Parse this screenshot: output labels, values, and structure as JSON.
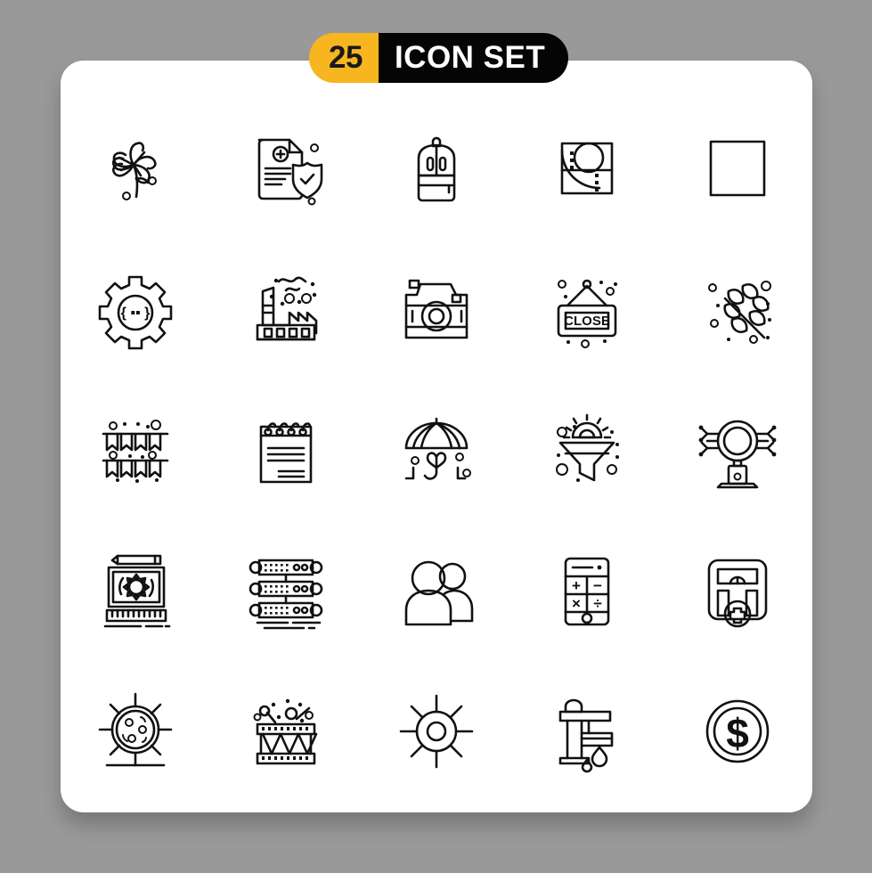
{
  "page": {
    "background_color": "#999999",
    "card_color": "#ffffff"
  },
  "header": {
    "count": "25",
    "title": "ICON SET",
    "count_bg": "#f7b620",
    "title_bg": "#050505",
    "count_text_color": "#1a1a1a",
    "title_text_color": "#ffffff"
  },
  "grid": {
    "columns": 5,
    "rows": 5,
    "total_icons": 25,
    "stroke_color": "#111111",
    "style": "line"
  },
  "icons": [
    {
      "index": 1,
      "name": "clover-icon",
      "label": "Clover"
    },
    {
      "index": 2,
      "name": "medical-document-shield-icon",
      "label": "Medical Document Shield"
    },
    {
      "index": 3,
      "name": "backpack-icon",
      "label": "Backpack"
    },
    {
      "index": 4,
      "name": "design-grid-icon",
      "label": "Design Grid"
    },
    {
      "index": 5,
      "name": "square-icon",
      "label": "Square"
    },
    {
      "index": 6,
      "name": "code-settings-gear-icon",
      "label": "Code Settings"
    },
    {
      "index": 7,
      "name": "factory-icon",
      "label": "Factory"
    },
    {
      "index": 8,
      "name": "camera-icon",
      "label": "Camera"
    },
    {
      "index": 9,
      "name": "close-sign-icon",
      "label": "Close Sign",
      "sign_text": "CLOSE"
    },
    {
      "index": 10,
      "name": "leaves-branch-icon",
      "label": "Leaves Branch"
    },
    {
      "index": 11,
      "name": "bunting-flags-icon",
      "label": "Bunting Flags"
    },
    {
      "index": 12,
      "name": "notepad-icon",
      "label": "Notepad"
    },
    {
      "index": 13,
      "name": "umbrella-heart-icon",
      "label": "Umbrella Heart"
    },
    {
      "index": 14,
      "name": "funnel-gear-icon",
      "label": "Funnel Gear"
    },
    {
      "index": 15,
      "name": "ai-processor-icon",
      "label": "AI Processor"
    },
    {
      "index": 16,
      "name": "design-board-icon",
      "label": "Design Board"
    },
    {
      "index": 17,
      "name": "server-rack-icon",
      "label": "Server Rack"
    },
    {
      "index": 18,
      "name": "users-group-icon",
      "label": "Users Group"
    },
    {
      "index": 19,
      "name": "calculator-icon",
      "label": "Calculator",
      "keys": [
        "+",
        "−",
        "×",
        "÷"
      ]
    },
    {
      "index": 20,
      "name": "weighing-scale-icon",
      "label": "Weighing Scale"
    },
    {
      "index": 21,
      "name": "virus-cell-icon",
      "label": "Virus Cell"
    },
    {
      "index": 22,
      "name": "drum-icon",
      "label": "Drum"
    },
    {
      "index": 23,
      "name": "sun-icon",
      "label": "Sun"
    },
    {
      "index": 24,
      "name": "water-tap-icon",
      "label": "Water Tap"
    },
    {
      "index": 25,
      "name": "dollar-coin-icon",
      "label": "Dollar Coin",
      "symbol": "$"
    }
  ]
}
